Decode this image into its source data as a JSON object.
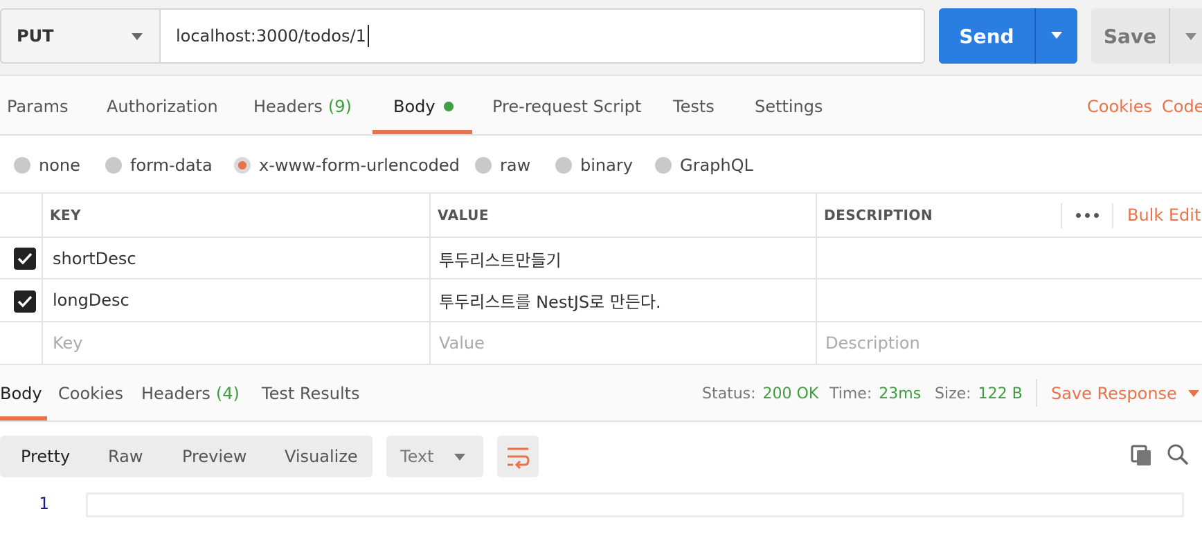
{
  "request": {
    "method": "PUT",
    "url": "localhost:3000/todos/1",
    "send_label": "Send",
    "save_label": "Save"
  },
  "request_tabs": {
    "params": "Params",
    "authorization": "Authorization",
    "headers": "Headers",
    "headers_count": "(9)",
    "body": "Body",
    "pre_request": "Pre-request Script",
    "tests": "Tests",
    "settings": "Settings",
    "active": "Body"
  },
  "request_links": {
    "cookies": "Cookies",
    "code": "Code"
  },
  "body_types": {
    "options": [
      "none",
      "form-data",
      "x-www-form-urlencoded",
      "raw",
      "binary",
      "GraphQL"
    ],
    "selected": "x-www-form-urlencoded"
  },
  "params_table": {
    "headers": {
      "key": "KEY",
      "value": "VALUE",
      "description": "DESCRIPTION"
    },
    "bulk_edit": "Bulk Edit",
    "rows": [
      {
        "checked": true,
        "key": "shortDesc",
        "value": "투두리스트만들기",
        "description": ""
      },
      {
        "checked": true,
        "key": "longDesc",
        "value": "투두리스트를 NestJS로 만든다.",
        "description": ""
      }
    ],
    "placeholders": {
      "key": "Key",
      "value": "Value",
      "description": "Description"
    }
  },
  "response_tabs": {
    "body": "Body",
    "cookies": "Cookies",
    "headers": "Headers",
    "headers_count": "(4)",
    "test_results": "Test Results",
    "active": "Body"
  },
  "response_meta": {
    "status_label": "Status:",
    "status_value": "200 OK",
    "time_label": "Time:",
    "time_value": "23ms",
    "size_label": "Size:",
    "size_value": "122 B",
    "save_response": "Save Response"
  },
  "response_toolbar": {
    "formats": [
      "Pretty",
      "Raw",
      "Preview",
      "Visualize"
    ],
    "active_format": "Pretty",
    "language": "Text"
  },
  "response_body": {
    "line_numbers": [
      "1"
    ]
  },
  "colors": {
    "accent": "#e8734a",
    "send": "#2a7de1",
    "success": "#3e9d3e"
  }
}
